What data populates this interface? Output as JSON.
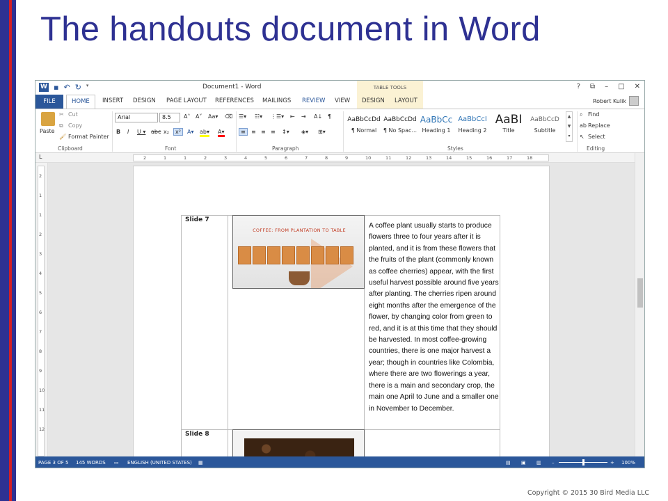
{
  "slide": {
    "title": "The handouts document in Word",
    "copyright": "Copyright © 2015 30 Bird Media LLC"
  },
  "word": {
    "doc_title": "Document1 - Word",
    "contextual_tab_group": "TABLE TOOLS",
    "user_name": "Robert Kulik",
    "tabs": [
      "FILE",
      "HOME",
      "INSERT",
      "DESIGN",
      "PAGE LAYOUT",
      "REFERENCES",
      "MAILINGS",
      "REVIEW",
      "VIEW",
      "DESIGN",
      "LAYOUT"
    ],
    "clipboard": {
      "paste": "Paste",
      "cut": "Cut",
      "copy": "Copy",
      "format_painter": "Format Painter",
      "label": "Clipboard"
    },
    "font": {
      "family": "Arial",
      "size": "8.5",
      "label": "Font"
    },
    "paragraph": {
      "label": "Paragraph"
    },
    "styles": {
      "label": "Styles",
      "items": [
        {
          "sample": "AaBbCcDd",
          "name": "¶ Normal"
        },
        {
          "sample": "AaBbCcDd",
          "name": "¶ No Spac..."
        },
        {
          "sample": "AaBbCc",
          "name": "Heading 1"
        },
        {
          "sample": "AaBbCcI",
          "name": "Heading 2"
        },
        {
          "sample": "AaBI",
          "name": "Title"
        },
        {
          "sample": "AaBbCcD",
          "name": "Subtitle"
        }
      ]
    },
    "editing": {
      "find": "Find",
      "replace": "Replace",
      "select": "Select",
      "label": "Editing"
    },
    "ruler_numbers": [
      "2",
      "1",
      "1",
      "2",
      "3",
      "4",
      "5",
      "6",
      "7",
      "8",
      "9",
      "10",
      "11",
      "12",
      "13",
      "14",
      "15",
      "16",
      "17",
      "18"
    ],
    "vruler_numbers": [
      "2",
      "1",
      "1",
      "2",
      "3",
      "4",
      "5",
      "6",
      "7",
      "8",
      "9",
      "10",
      "11",
      "12"
    ],
    "doc": {
      "slide7_label": "Slide 7",
      "slide7_thumb_title": "COFFEE: FROM PLANTATION TO TABLE",
      "slide7_notes": "A coffee plant usually starts to produce flowers three to four years after it is planted, and it is from these flowers that the fruits of the plant (commonly known as coffee cherries) appear, with the first useful harvest possible around five years after planting. The cherries ripen around eight months after the emergence of the flower, by changing color from green to red, and it is at this time that they should be harvested. In most coffee-growing countries, there is one major harvest a year; though in countries like Colombia, where there are two flowerings a year, there is a main and secondary crop, the main one April to June and a smaller one in November to December.",
      "slide8_label": "Slide 8"
    },
    "status": {
      "page": "PAGE 3 OF 5",
      "words": "145 WORDS",
      "language": "ENGLISH (UNITED STATES)",
      "zoom": "100%"
    }
  }
}
